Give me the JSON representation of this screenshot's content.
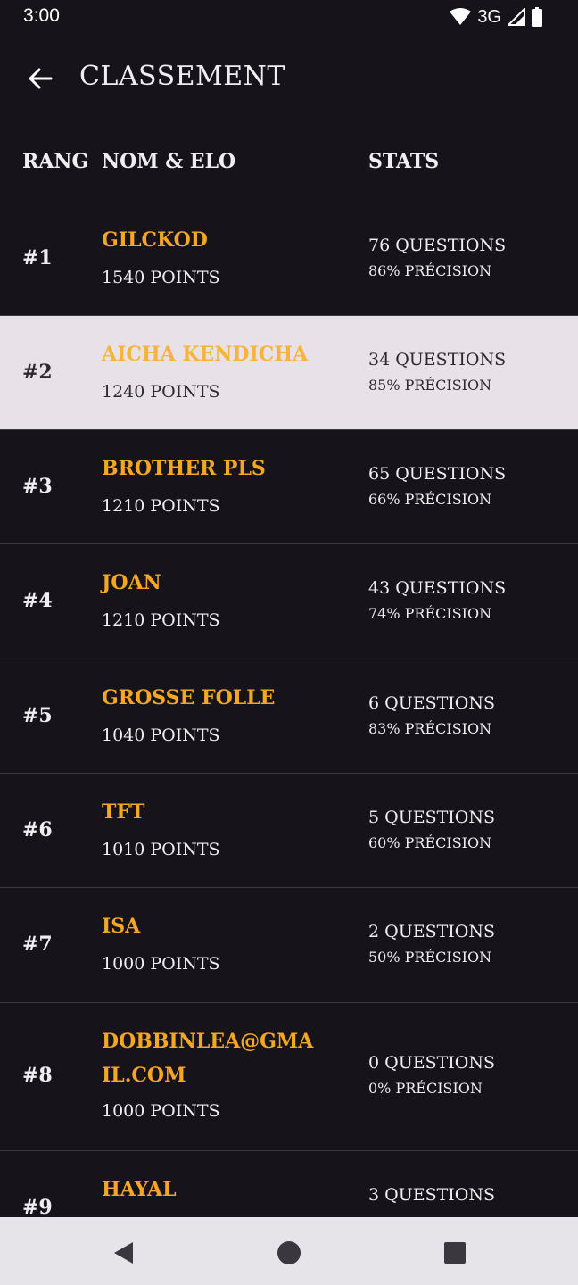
{
  "status_bar": {
    "time": "3:00",
    "network": "3G"
  },
  "app_bar": {
    "title": "CLASSEMENT"
  },
  "table_header": {
    "rank": "RANG",
    "name": "NOM & ELO",
    "stats": "STATS"
  },
  "rows": [
    {
      "rank": "#1",
      "name": "GILCKOD",
      "points": "1540 POINTS",
      "questions": "76 QUESTIONS",
      "precision": "86% PRÉCISION"
    },
    {
      "rank": "#2",
      "name": "AICHA KENDICHA",
      "points": "1240 POINTS",
      "questions": "34 QUESTIONS",
      "precision": "85% PRÉCISION"
    },
    {
      "rank": "#3",
      "name": "BROTHER PLS",
      "points": "1210 POINTS",
      "questions": "65 QUESTIONS",
      "precision": "66% PRÉCISION"
    },
    {
      "rank": "#4",
      "name": "JOAN",
      "points": "1210 POINTS",
      "questions": "43 QUESTIONS",
      "precision": "74% PRÉCISION"
    },
    {
      "rank": "#5",
      "name": "GROSSE FOLLE",
      "points": "1040 POINTS",
      "questions": "6 QUESTIONS",
      "precision": "83% PRÉCISION"
    },
    {
      "rank": "#6",
      "name": "TFT",
      "points": "1010 POINTS",
      "questions": "5 QUESTIONS",
      "precision": "60% PRÉCISION"
    },
    {
      "rank": "#7",
      "name": "ISA",
      "points": "1000 POINTS",
      "questions": "2 QUESTIONS",
      "precision": "50% PRÉCISION"
    },
    {
      "rank": "#8",
      "name": "DOBBINLEA@GMAIL.COM",
      "points": "1000 POINTS",
      "questions": "0 QUESTIONS",
      "precision": "0% PRÉCISION"
    },
    {
      "rank": "#9",
      "name": "HAYAL",
      "points": "",
      "questions": "3 QUESTIONS",
      "precision": ""
    }
  ],
  "colors": {
    "background": "#16141a",
    "name_accent": "#f5a623",
    "highlight_row": "#e8e2e8"
  },
  "icons": {
    "back": "arrow-left-icon",
    "wifi": "wifi-icon",
    "signal": "cell-signal-icon",
    "battery": "battery-icon",
    "nav_back": "triangle-back-icon",
    "nav_home": "circle-home-icon",
    "nav_recents": "square-recents-icon"
  }
}
